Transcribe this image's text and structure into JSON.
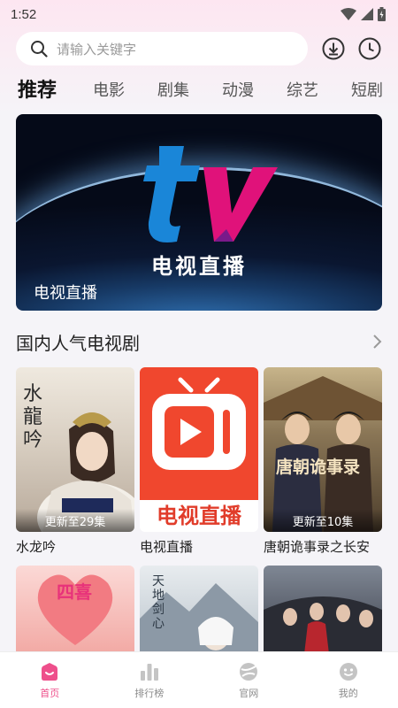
{
  "status_bar": {
    "time": "1:52",
    "icons": [
      "wifi-icon",
      "cellular-signal-icon",
      "battery-icon"
    ]
  },
  "search": {
    "placeholder": "请输入关键字"
  },
  "header_icons": [
    "download-icon",
    "history-clock-icon"
  ],
  "tabs": [
    {
      "label": "推荐",
      "active": true
    },
    {
      "label": "电影"
    },
    {
      "label": "剧集"
    },
    {
      "label": "动漫"
    },
    {
      "label": "综艺"
    },
    {
      "label": "短剧"
    }
  ],
  "banner": {
    "logo_text": "电视直播",
    "caption": "电视直播"
  },
  "section": {
    "title": "国内人气电视剧"
  },
  "shows": [
    {
      "title": "水龙吟",
      "badge": "更新至29集",
      "poster_text": "水龍吟"
    },
    {
      "title": "电视直播",
      "badge": "",
      "poster_text": "电视直播"
    },
    {
      "title": "唐朝诡事录之长安",
      "badge": "更新至10集",
      "poster_text": "唐朝诡事录"
    },
    {
      "title": "",
      "badge": "",
      "poster_text": "四喜"
    },
    {
      "title": "",
      "badge": "",
      "poster_text": "天地剑心"
    },
    {
      "title": "",
      "badge": "",
      "poster_text": ""
    }
  ],
  "bottom_nav": [
    {
      "label": "首页",
      "icon": "home-icon",
      "active": true
    },
    {
      "label": "排行榜",
      "icon": "ranking-chart-icon"
    },
    {
      "label": "官网",
      "icon": "website-globe-icon"
    },
    {
      "label": "我的",
      "icon": "profile-face-icon"
    }
  ],
  "colors": {
    "accent": "#ee4f8b",
    "tv_red": "#f0472e",
    "tv_blue": "#1a86d8",
    "tv_magenta": "#e0127a"
  }
}
